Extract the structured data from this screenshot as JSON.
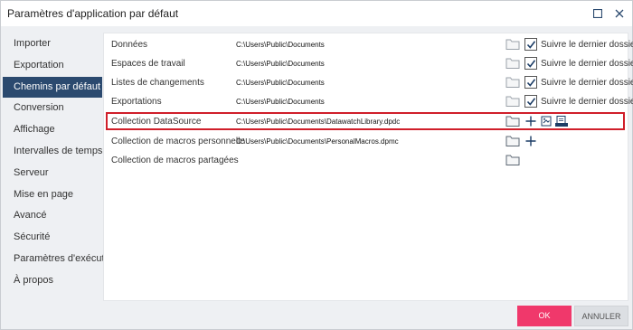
{
  "window": {
    "title": "Paramètres d'application par défaut",
    "maximize_icon": "maximize-icon",
    "close_icon": "close-icon"
  },
  "sidebar": {
    "items": [
      {
        "label": "Importer"
      },
      {
        "label": "Exportation"
      },
      {
        "label": "Chemins par défaut",
        "active": true
      },
      {
        "label": "Conversion"
      },
      {
        "label": "Affichage"
      },
      {
        "label": "Intervalles de temps"
      },
      {
        "label": "Serveur"
      },
      {
        "label": "Mise en page"
      },
      {
        "label": "Avancé"
      },
      {
        "label": "Sécurité"
      },
      {
        "label": "Paramètres d'exécution"
      },
      {
        "label": "À propos"
      }
    ]
  },
  "paths": {
    "rows": [
      {
        "label": "Données",
        "path": "C:\\Users\\Public\\Documents",
        "follow_last": true,
        "follow_label": "Suivre le dernier dossier"
      },
      {
        "label": "Espaces de travail",
        "path": "C:\\Users\\Public\\Documents",
        "follow_last": true,
        "follow_label": "Suivre le dernier dossier"
      },
      {
        "label": "Listes de changements",
        "path": "C:\\Users\\Public\\Documents",
        "follow_last": true,
        "follow_label": "Suivre le dernier dossier"
      },
      {
        "label": "Exportations",
        "path": "C:\\Users\\Public\\Documents",
        "follow_last": true,
        "follow_label": "Suivre le dernier dossier"
      },
      {
        "label": "Collection DataSource",
        "path": "C:\\Users\\Public\\Documents\\DatawatchLibrary.dpdc",
        "highlighted": true
      },
      {
        "label": "Collection de macros personnelle",
        "path": "C:\\Users\\Public\\Documents\\PersonalMacros.dpmc"
      },
      {
        "label": "Collection de macros partagées",
        "path": ""
      }
    ]
  },
  "footer": {
    "ok_label": "OK",
    "cancel_label": "ANNULER"
  },
  "colors": {
    "sidebar_active": "#2b4a6f",
    "ok_button": "#f0386b",
    "highlight_border": "#d01f2a"
  }
}
